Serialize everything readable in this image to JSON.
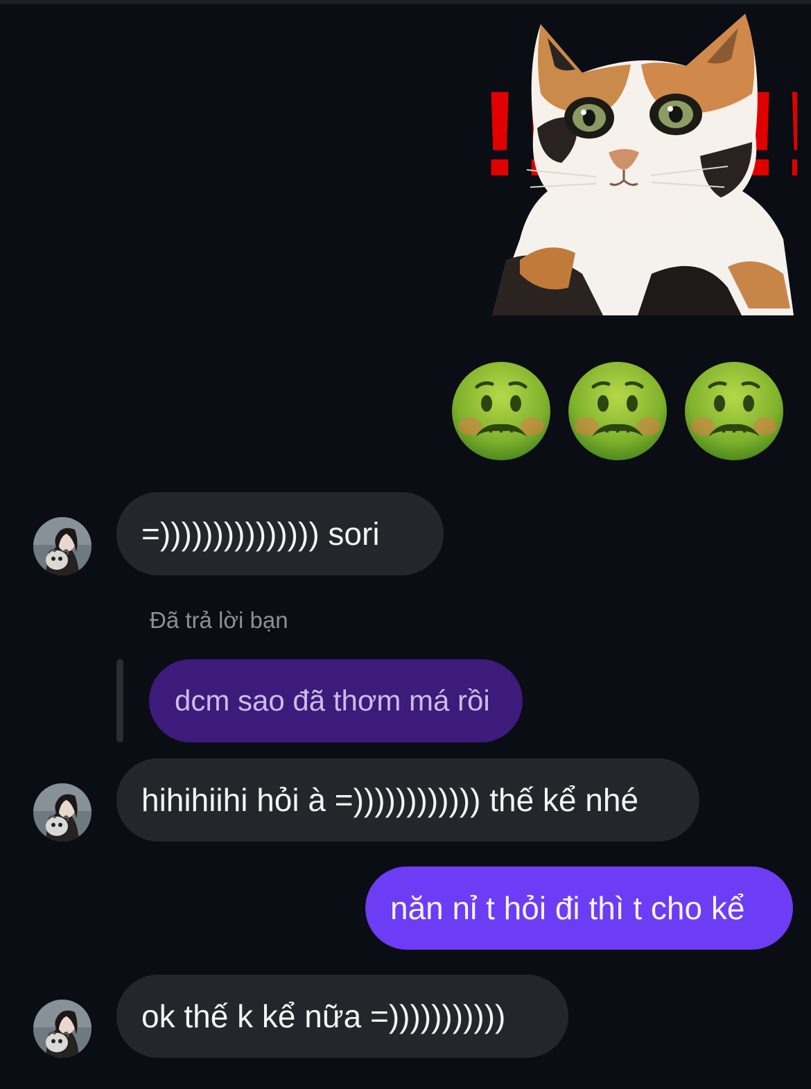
{
  "messages": {
    "sticker": {
      "label": "!!",
      "icon": "cat-sticker"
    },
    "emojis": [
      "nauseated-face",
      "nauseated-face",
      "nauseated-face"
    ],
    "incoming_1": {
      "text": "=))))))))))))))) sori"
    },
    "reply_context": {
      "label": "Đã trả lời bạn",
      "quoted_text": "dcm sao đã thơm má rồi"
    },
    "incoming_2": {
      "text": "hihihiihi hỏi à =)))))))))))) thế kể nhé"
    },
    "outgoing_1": {
      "text": "năn nỉ t hỏi đi thì t cho kể"
    },
    "incoming_3": {
      "text": "ok thế k kể nữa =)))))))))))"
    }
  },
  "colors": {
    "background": "#0a0d13",
    "incoming_bubble": "#24262b",
    "outgoing_bubble": "#6d3cf5",
    "quoted_bubble": "#3c1b7a",
    "text": "#f4f4f6",
    "muted_text": "#8d9096",
    "sticker_exclamation": "#e00000"
  }
}
